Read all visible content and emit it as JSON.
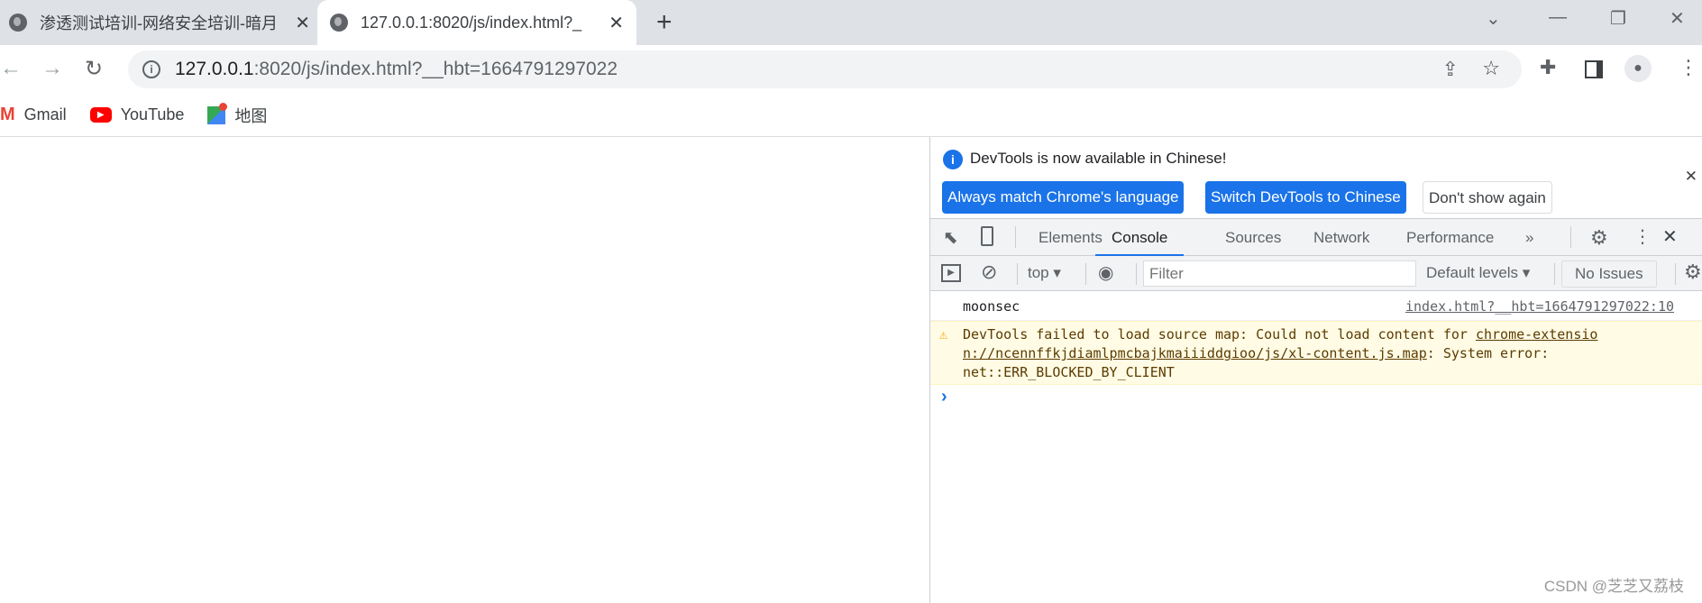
{
  "tabs": [
    {
      "title": "渗透测试培训-网络安全培训-暗月",
      "active": false
    },
    {
      "title": "127.0.0.1:8020/js/index.html?_",
      "active": true
    }
  ],
  "address": {
    "host": "127.0.0.1",
    "rest": ":8020/js/index.html?__hbt=1664791297022"
  },
  "bookmarks": [
    {
      "label": "Gmail"
    },
    {
      "label": "YouTube"
    },
    {
      "label": "地图"
    }
  ],
  "devtools": {
    "infobar": {
      "message": "DevTools is now available in Chinese!",
      "btn_match": "Always match Chrome's language",
      "btn_switch": "Switch DevTools to Chinese",
      "btn_dont": "Don't show again"
    },
    "tabs": [
      "Elements",
      "Console",
      "Sources",
      "Network",
      "Performance"
    ],
    "active_tab": "Console",
    "context": "top",
    "filter_placeholder": "Filter",
    "levels": "Default levels",
    "issues": "No Issues",
    "messages": [
      {
        "text": "moonsec",
        "source": "index.html?__hbt=1664791297022:10"
      },
      {
        "type": "warning",
        "text1": "DevTools failed to load source map: Could not load content for ",
        "link1": "chrome-extensio",
        "link2": "n://ncennffkjdiamlpmcbajkmaiiiddgioo/js/xl-content.js.map",
        "text2": ": System error:",
        "text3": "net::ERR_BLOCKED_BY_CLIENT"
      }
    ],
    "prompt": "›"
  },
  "watermark": "CSDN @芝芝又荔枝"
}
